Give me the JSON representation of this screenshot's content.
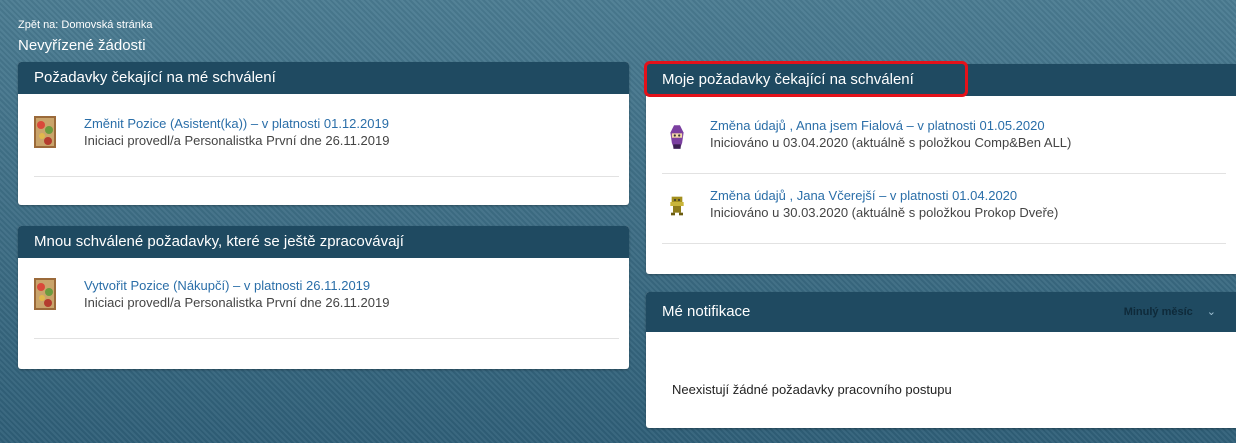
{
  "nav": {
    "back_link": "Zpět na: Domovská stránka",
    "page_title": "Nevyřízené žádosti"
  },
  "awaiting_my_approval": {
    "header": "Požadavky čekající na mé schválení",
    "items": [
      {
        "title": "Změnit Pozice (Asistent(ka)) – v platnosti 01.12.2019",
        "subtitle": "Iniciaci provedl/a Personalistka První dne 26.11.2019",
        "icon": "person-photo-thumbnail"
      }
    ]
  },
  "approved_in_progress": {
    "header": "Mnou schválené požadavky, které se ještě zpracovávají",
    "items": [
      {
        "title": "Vytvořit Pozice (Nákupčí) – v platnosti 26.11.2019",
        "subtitle": "Iniciaci provedl/a Personalistka První dne 26.11.2019",
        "icon": "person-photo-thumbnail"
      }
    ]
  },
  "my_pending_requests": {
    "header": "Moje požadavky čekající na schválení",
    "items": [
      {
        "title": "Změna údajů , Anna jsem Fialová – v platnosti 01.05.2020",
        "subtitle": "Iniciováno u 03.04.2020 (aktuálně s položkou Comp&Ben ALL)",
        "icon": "purple-avatar-icon"
      },
      {
        "title": "Změna údajů , Jana Včerejší – v platnosti 01.04.2020",
        "subtitle": "Iniciováno u 30.03.2020 (aktuálně s položkou Prokop Dveře)",
        "icon": "olive-avatar-icon"
      }
    ]
  },
  "notifications": {
    "header": "Mé notifikace",
    "filter_label": "Minulý měsíc",
    "empty_message": "Neexistují žádné požadavky pracovního postupu"
  },
  "colors": {
    "header_bg": "#1f4a61",
    "link": "#2a6ea8",
    "highlight": "#e4111a"
  }
}
